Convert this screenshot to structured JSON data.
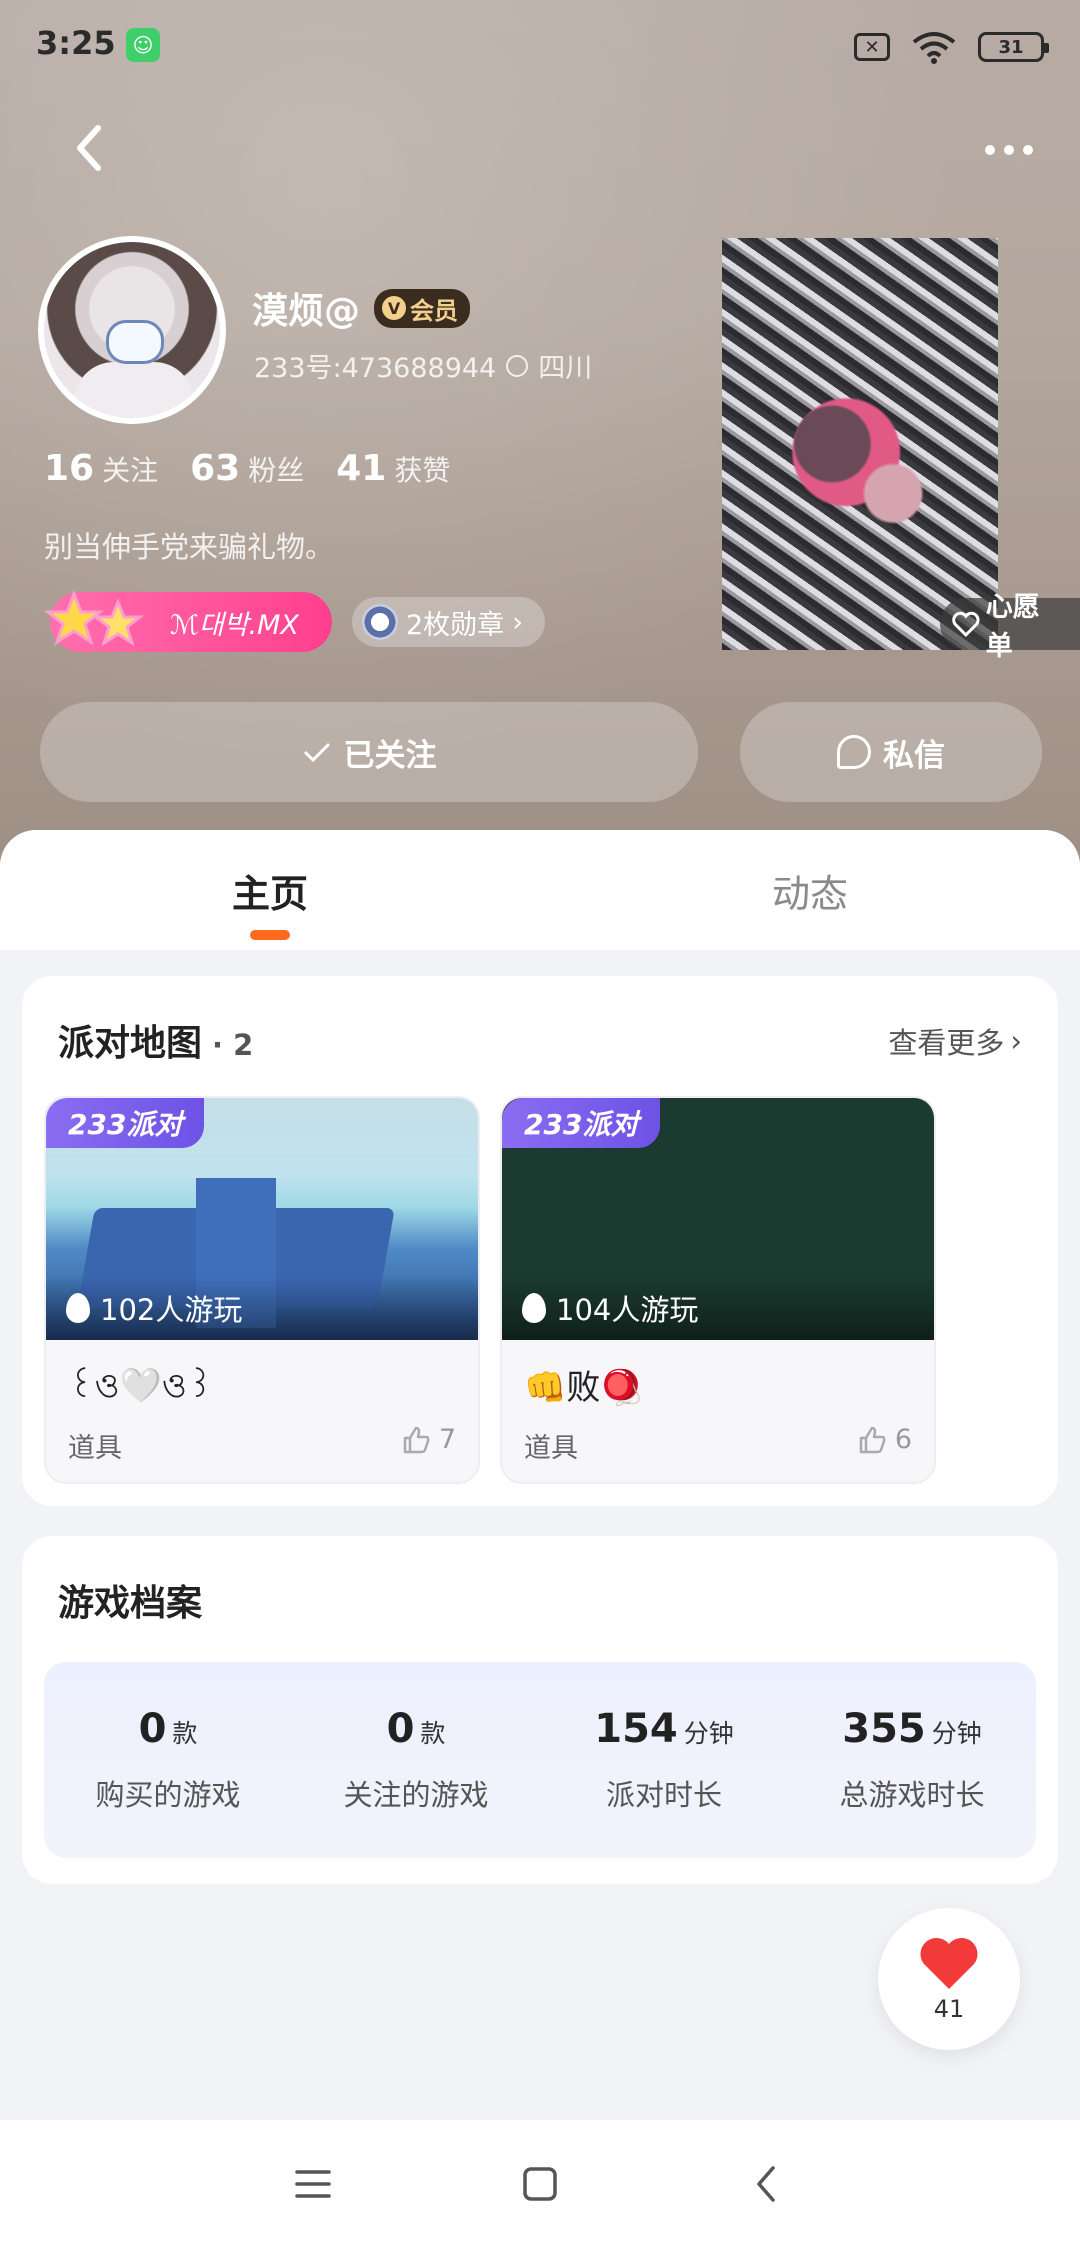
{
  "status_bar": {
    "time": "3:25",
    "battery": "31"
  },
  "profile": {
    "username": "漠烦@",
    "vip_label": "会员",
    "id_text": "233号:473688944",
    "location": "四川",
    "stats": [
      {
        "value": "16",
        "label": "关注"
      },
      {
        "value": "63",
        "label": "粉丝"
      },
      {
        "value": "41",
        "label": "获赞"
      }
    ],
    "bio": "别当伸手党来骗礼物。",
    "title_badge": "ℳ대박.MX",
    "medals_label": "2枚勋章"
  },
  "wishlist_label": "心愿单",
  "actions": {
    "followed": "已关注",
    "message": "私信"
  },
  "tabs": [
    {
      "label": "主页",
      "active": true
    },
    {
      "label": "动态",
      "active": false
    }
  ],
  "party_maps": {
    "title": "派对地图",
    "count": "· 2",
    "see_more": "查看更多",
    "items": [
      {
        "brand": "233派对",
        "players": "102人游玩",
        "name": "꒰ও🤍ও꒱",
        "type": "道具",
        "likes": "7"
      },
      {
        "brand": "233派对",
        "players": "104人游玩",
        "name": "👊败🪀",
        "type": "道具",
        "likes": "6"
      }
    ]
  },
  "game_archive": {
    "title": "游戏档案",
    "stats": [
      {
        "value": "0",
        "unit": "款",
        "label": "购买的游戏"
      },
      {
        "value": "0",
        "unit": "款",
        "label": "关注的游戏"
      },
      {
        "value": "154",
        "unit": "分钟",
        "label": "派对时长"
      },
      {
        "value": "355",
        "unit": "分钟",
        "label": "总游戏时长"
      }
    ]
  },
  "like_fab": {
    "count": "41"
  },
  "colors": {
    "accent": "#ff6a1f",
    "brand_purple": "#7a5cf0",
    "pink": "#ff4f95"
  }
}
